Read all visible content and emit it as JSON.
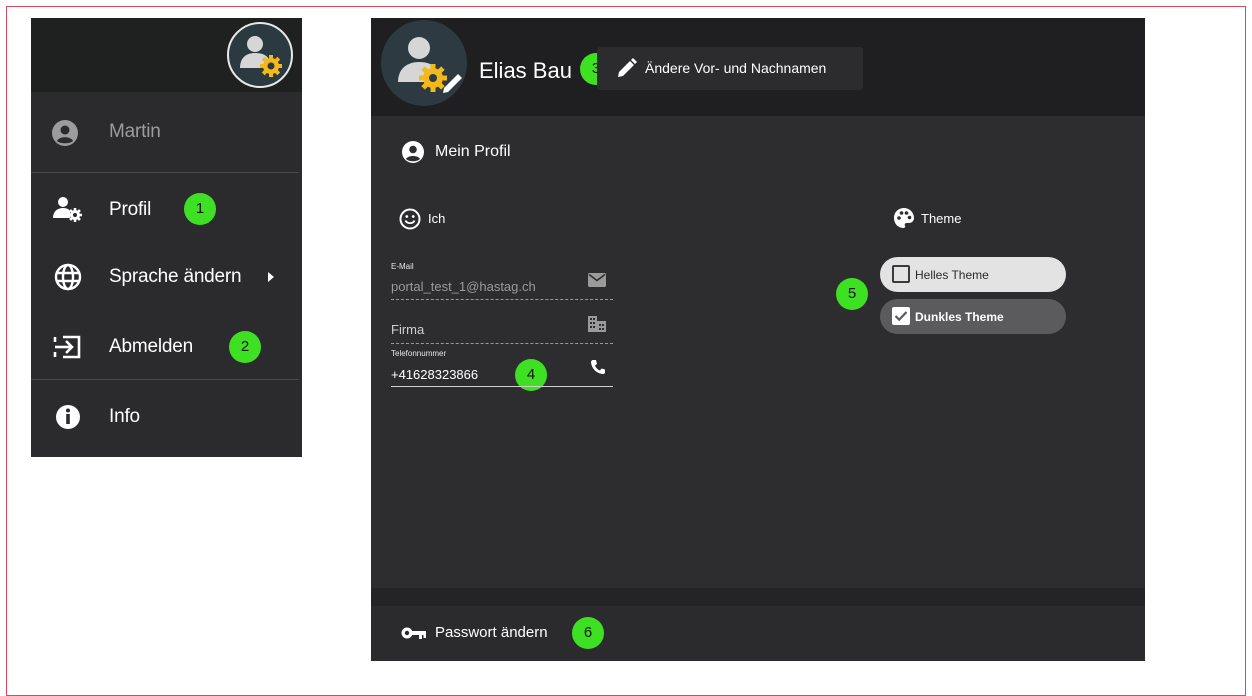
{
  "menu": {
    "user_name": "Martin",
    "items": [
      {
        "label": "Profil",
        "icon": "user-gear-icon",
        "badge": "1"
      },
      {
        "label": "Sprache ändern",
        "icon": "globe-icon",
        "badge": ""
      },
      {
        "label": "Abmelden",
        "icon": "logout-icon",
        "badge": "2"
      },
      {
        "label": "Info",
        "icon": "info-icon",
        "badge": ""
      }
    ]
  },
  "profile": {
    "name": "Elias Bau",
    "edit_name_label": "Ändere Vor- und Nachnamen",
    "edit_name_badge": "3",
    "section_title": "Mein Profil",
    "me_title": "Ich",
    "fields": {
      "email_label": "E-Mail",
      "email_value": "portal_test_1@hastag.ch",
      "company_placeholder": "Firma",
      "phone_label": "Telefonnummer",
      "phone_value": "+41628323866",
      "phone_badge": "4"
    },
    "theme": {
      "title": "Theme",
      "light_label": "Helles Theme",
      "dark_label": "Dunkles Theme",
      "badge": "5",
      "selected": "Dunkles Theme"
    },
    "password_label": "Passwort ändern",
    "password_badge": "6"
  },
  "colors": {
    "badge": "#3ee023",
    "dark_bg": "#2d2d30",
    "accent_gold": "#f3b81a"
  }
}
